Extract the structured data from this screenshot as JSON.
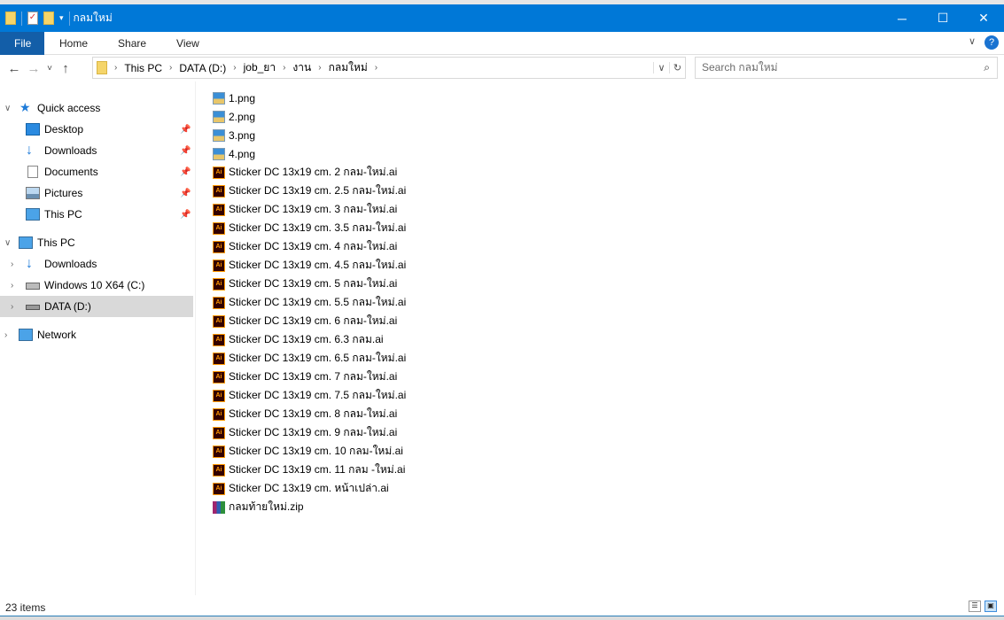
{
  "window": {
    "title": "กลมใหม่",
    "minimize": "─",
    "maximize": "☐",
    "close": "✕"
  },
  "ribbon": {
    "tabs": [
      "File",
      "Home",
      "Share",
      "View"
    ],
    "expand": "∨",
    "help": "?"
  },
  "address": {
    "back": "←",
    "forward": "→",
    "recent": "˅",
    "up": "↑",
    "crumbs": [
      "This PC",
      "DATA (D:)",
      "job_ยา",
      "งาน",
      "กลมใหม่"
    ],
    "dropdown": "∨",
    "refresh": "↻"
  },
  "search": {
    "placeholder": "Search กลมใหม่",
    "icon": "⌕"
  },
  "nav": {
    "quick_access": "Quick access",
    "quick_items": [
      "Desktop",
      "Downloads",
      "Documents",
      "Pictures",
      "This PC"
    ],
    "this_pc": "This PC",
    "pc_items": [
      "Downloads",
      "Windows 10 X64 (C:)",
      "DATA (D:)"
    ],
    "network": "Network"
  },
  "files": [
    {
      "name": "1.png",
      "type": "png"
    },
    {
      "name": "2.png",
      "type": "png"
    },
    {
      "name": "3.png",
      "type": "png"
    },
    {
      "name": "4.png",
      "type": "png"
    },
    {
      "name": "Sticker DC 13x19 cm. 2 กลม-ใหม่.ai",
      "type": "ai"
    },
    {
      "name": "Sticker DC 13x19 cm. 2.5 กลม-ใหม่.ai",
      "type": "ai"
    },
    {
      "name": "Sticker DC 13x19 cm. 3 กลม-ใหม่.ai",
      "type": "ai"
    },
    {
      "name": "Sticker DC 13x19 cm. 3.5 กลม-ใหม่.ai",
      "type": "ai"
    },
    {
      "name": "Sticker DC 13x19 cm. 4 กลม-ใหม่.ai",
      "type": "ai"
    },
    {
      "name": "Sticker DC 13x19 cm. 4.5 กลม-ใหม่.ai",
      "type": "ai"
    },
    {
      "name": "Sticker DC 13x19 cm. 5 กลม-ใหม่.ai",
      "type": "ai"
    },
    {
      "name": "Sticker DC 13x19 cm. 5.5 กลม-ใหม่.ai",
      "type": "ai"
    },
    {
      "name": "Sticker DC 13x19 cm. 6 กลม-ใหม่.ai",
      "type": "ai"
    },
    {
      "name": "Sticker DC 13x19 cm. 6.3 กลม.ai",
      "type": "ai"
    },
    {
      "name": "Sticker DC 13x19 cm. 6.5 กลม-ใหม่.ai",
      "type": "ai"
    },
    {
      "name": "Sticker DC 13x19 cm. 7 กลม-ใหม่.ai",
      "type": "ai"
    },
    {
      "name": "Sticker DC 13x19 cm. 7.5 กลม-ใหม่.ai",
      "type": "ai"
    },
    {
      "name": "Sticker DC 13x19 cm. 8 กลม-ใหม่.ai",
      "type": "ai"
    },
    {
      "name": "Sticker DC 13x19 cm. 9 กลม-ใหม่.ai",
      "type": "ai"
    },
    {
      "name": "Sticker DC 13x19 cm. 10 กลม-ใหม่.ai",
      "type": "ai"
    },
    {
      "name": "Sticker DC 13x19 cm. 11 กลม -ใหม่.ai",
      "type": "ai"
    },
    {
      "name": "Sticker DC 13x19 cm. หน้าเปล่า.ai",
      "type": "ai"
    },
    {
      "name": "กลมท้ายใหม่.zip",
      "type": "zip"
    }
  ],
  "status": {
    "count": "23 items"
  },
  "colors": {
    "titlebar": "#0078d7",
    "file_tab": "#135ea8",
    "selected": "#d9d9d9"
  }
}
